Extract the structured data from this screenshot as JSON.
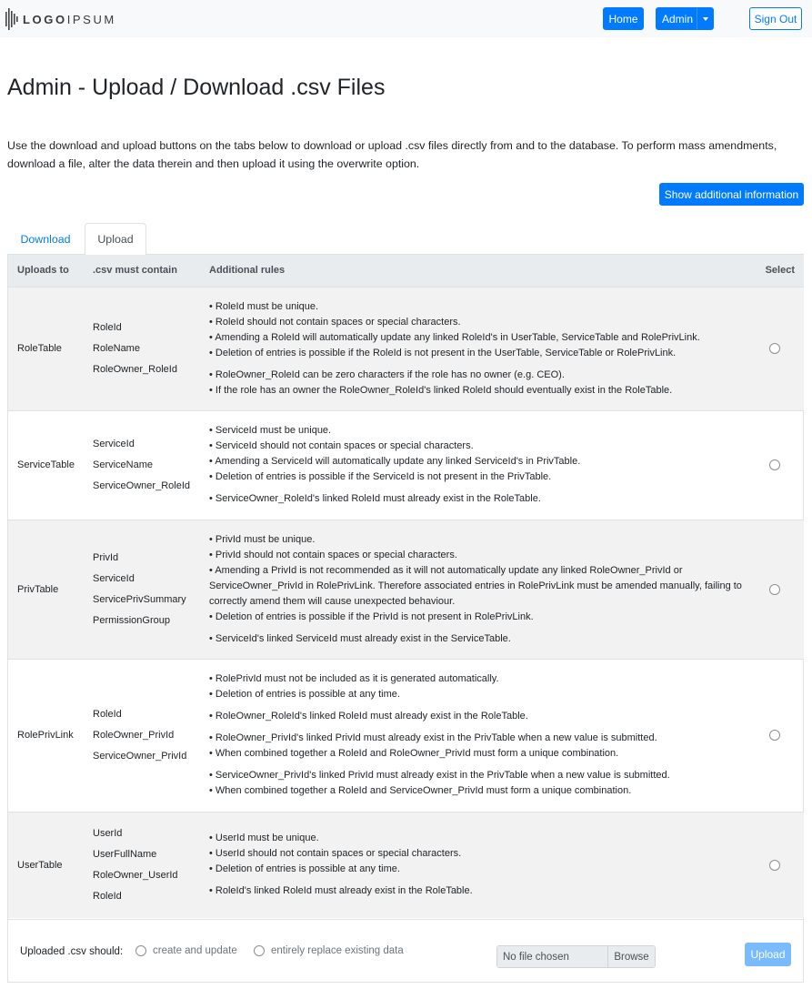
{
  "logo": {
    "part1": "LOGO",
    "part2": "IPSUM"
  },
  "nav": {
    "home": "Home",
    "admin": "Admin",
    "sign_out": "Sign Out"
  },
  "page": {
    "title": "Admin - Upload / Download .csv Files",
    "intro": "Use the download and upload buttons on the tabs below to download or upload .csv files directly from and to the database. To perform mass amendments, download a file, alter the data therein and then upload it using the overwrite option.",
    "info_button": "Show additional information"
  },
  "tabs": {
    "download": "Download",
    "upload": "Upload"
  },
  "table": {
    "headers": {
      "uploads_to": "Uploads to",
      "csv_must_contain": ".csv must contain",
      "rules": "Additional rules",
      "select": "Select"
    },
    "rows": [
      {
        "name": "RoleTable",
        "fields": [
          "RoleId",
          "RoleName",
          "RoleOwner_RoleId"
        ],
        "rule_groups": [
          [
            "RoleId must be unique.",
            "RoleId should not contain spaces or special characters.",
            "Amending a RoleId will automatically update any linked RoleId's in UserTable, ServiceTable and RolePrivLink.",
            "Deletion of entries is possible if the RoleId is not present in the UserTable, ServiceTable or RolePrivLink."
          ],
          [
            "RoleOwner_RoleId can be zero characters if the role has no owner (e.g. CEO).",
            "If the role has an owner the RoleOwner_RoleId's linked RoleId should eventually exist in the RoleTable."
          ]
        ]
      },
      {
        "name": "ServiceTable",
        "fields": [
          "ServiceId",
          "ServiceName",
          "ServiceOwner_RoleId"
        ],
        "rule_groups": [
          [
            "ServiceId must be unique.",
            "ServiceId should not contain spaces or special characters.",
            "Amending a ServiceId will automatically update any linked ServiceId's in PrivTable.",
            "Deletion of entries is possible if the ServiceId is not present in the PrivTable."
          ],
          [
            "ServiceOwner_RoleId's linked RoleId must already exist in the RoleTable."
          ]
        ]
      },
      {
        "name": "PrivTable",
        "fields": [
          "PrivId",
          "ServiceId",
          "ServicePrivSummary",
          "PermissionGroup"
        ],
        "rule_groups": [
          [
            "PrivId must be unique.",
            "PrivId should not contain spaces or special characters.",
            "Amending a PrivId is not recommended as it will not automatically update any linked RoleOwner_PrivId or ServiceOwner_PrivId in RolePrivLink. Therefore associated entries in RolePrivLink must be amended manually, failing to correctly amend them will cause unexpected behaviour.",
            "Deletion of entries is possible if the PrivId is not present in RolePrivLink."
          ],
          [
            "ServiceId's linked ServiceId must already exist in the ServiceTable."
          ]
        ]
      },
      {
        "name": "RolePrivLink",
        "fields": [
          "RoleId",
          "RoleOwner_PrivId",
          "ServiceOwner_PrivId"
        ],
        "rule_groups": [
          [
            "RolePrivId must not be included as it is generated automatically.",
            "Deletion of entries is possible at any time."
          ],
          [
            "RoleOwner_RoleId's linked RoleId must already exist in the RoleTable."
          ],
          [
            "RoleOwner_PrivId's linked PrivId must already exist in the PrivTable when a new value is submitted.",
            "When combined together a RoleId and RoleOwner_PrivId must form a unique combination."
          ],
          [
            "ServiceOwner_PrivId's linked PrivId must already exist in the PrivTable when a new value is submitted.",
            "When combined together a RoleId and ServiceOwner_PrivId must form a unique combination."
          ]
        ]
      },
      {
        "name": "UserTable",
        "fields": [
          "UserId",
          "UserFullName",
          "RoleOwner_UserId",
          "RoleId"
        ],
        "rule_groups": [
          [
            "UserId must be unique.",
            "UserId should not contain spaces or special characters.",
            "Deletion of entries is possible at any time."
          ],
          [
            "RoleId's linked RoleId must already exist in the RoleTable."
          ]
        ]
      }
    ]
  },
  "footer": {
    "label": "Uploaded .csv should:",
    "option1": "create and update",
    "option2": "entirely replace existing data",
    "file_status": "No file chosen",
    "browse": "Browse",
    "upload": "Upload"
  },
  "colors": {
    "primary": "#007bff",
    "row_alt": "#f2f2f2",
    "header_bg": "#e9ecef"
  }
}
